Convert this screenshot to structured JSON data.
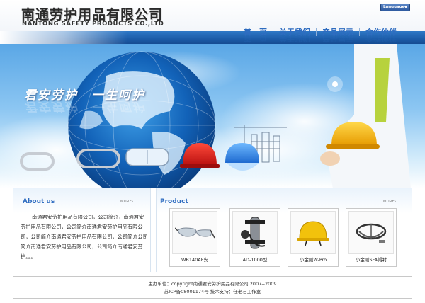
{
  "header": {
    "company_cn": "南通劳护用品有限公司",
    "company_en": "NANTONG SAFETY PRODUCTS CO.,LTD",
    "language_label": "Language"
  },
  "nav": {
    "items": [
      {
        "label": "首　页"
      },
      {
        "label": "关于我们"
      },
      {
        "label": "产品展示"
      },
      {
        "label": "合作伙伴"
      }
    ]
  },
  "banner": {
    "slogan": "君安劳护　一生呵护"
  },
  "about": {
    "title": "About us",
    "more": "MORE›",
    "text": "南通君安劳护用品有限公司，公司简介，南通君安劳护用品有限公司，公司简介南通君安劳护用品有限公司，公司简介南通君安劳护用品有限公司，公司简介公司简介南通君安劳护用品有限公司，公司简介南通君安劳护。。。"
  },
  "products": {
    "title": "Product",
    "more": "MORE›",
    "items": [
      {
        "name": "WB140AF安",
        "icon": "safety-goggles-icon"
      },
      {
        "name": "AD-1000型",
        "icon": "breathing-apparatus-icon"
      },
      {
        "name": "小金刚W-Pro",
        "icon": "yellow-helmet-icon"
      },
      {
        "name": "小金刚SFA帽衬",
        "icon": "helmet-suspension-icon"
      }
    ]
  },
  "footer": {
    "line1": "主办单位：copyright南通君安劳护用品有限公司 2007--2009",
    "line2": "苏ICP备08001174号  技术支持：任老石工作室"
  },
  "colors": {
    "brand_blue": "#1c5ca8",
    "nav_text": "#2e6cc0",
    "helmet_red": "#e0231c",
    "helmet_yellow": "#f2b90c"
  }
}
